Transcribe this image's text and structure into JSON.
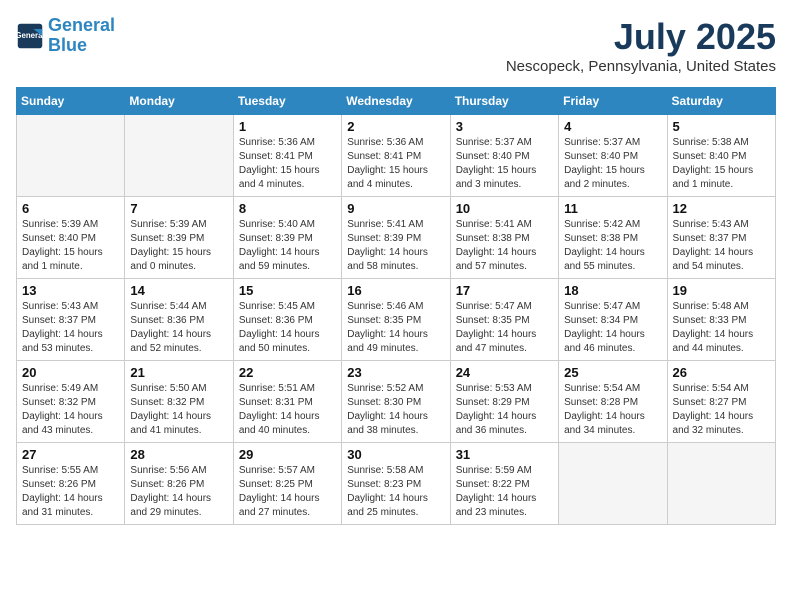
{
  "header": {
    "logo_line1": "General",
    "logo_line2": "Blue",
    "title": "July 2025",
    "subtitle": "Nescopeck, Pennsylvania, United States"
  },
  "days_of_week": [
    "Sunday",
    "Monday",
    "Tuesday",
    "Wednesday",
    "Thursday",
    "Friday",
    "Saturday"
  ],
  "weeks": [
    [
      {
        "day": "",
        "info": ""
      },
      {
        "day": "",
        "info": ""
      },
      {
        "day": "1",
        "info": "Sunrise: 5:36 AM\nSunset: 8:41 PM\nDaylight: 15 hours and 4 minutes."
      },
      {
        "day": "2",
        "info": "Sunrise: 5:36 AM\nSunset: 8:41 PM\nDaylight: 15 hours and 4 minutes."
      },
      {
        "day": "3",
        "info": "Sunrise: 5:37 AM\nSunset: 8:40 PM\nDaylight: 15 hours and 3 minutes."
      },
      {
        "day": "4",
        "info": "Sunrise: 5:37 AM\nSunset: 8:40 PM\nDaylight: 15 hours and 2 minutes."
      },
      {
        "day": "5",
        "info": "Sunrise: 5:38 AM\nSunset: 8:40 PM\nDaylight: 15 hours and 1 minute."
      }
    ],
    [
      {
        "day": "6",
        "info": "Sunrise: 5:39 AM\nSunset: 8:40 PM\nDaylight: 15 hours and 1 minute."
      },
      {
        "day": "7",
        "info": "Sunrise: 5:39 AM\nSunset: 8:39 PM\nDaylight: 15 hours and 0 minutes."
      },
      {
        "day": "8",
        "info": "Sunrise: 5:40 AM\nSunset: 8:39 PM\nDaylight: 14 hours and 59 minutes."
      },
      {
        "day": "9",
        "info": "Sunrise: 5:41 AM\nSunset: 8:39 PM\nDaylight: 14 hours and 58 minutes."
      },
      {
        "day": "10",
        "info": "Sunrise: 5:41 AM\nSunset: 8:38 PM\nDaylight: 14 hours and 57 minutes."
      },
      {
        "day": "11",
        "info": "Sunrise: 5:42 AM\nSunset: 8:38 PM\nDaylight: 14 hours and 55 minutes."
      },
      {
        "day": "12",
        "info": "Sunrise: 5:43 AM\nSunset: 8:37 PM\nDaylight: 14 hours and 54 minutes."
      }
    ],
    [
      {
        "day": "13",
        "info": "Sunrise: 5:43 AM\nSunset: 8:37 PM\nDaylight: 14 hours and 53 minutes."
      },
      {
        "day": "14",
        "info": "Sunrise: 5:44 AM\nSunset: 8:36 PM\nDaylight: 14 hours and 52 minutes."
      },
      {
        "day": "15",
        "info": "Sunrise: 5:45 AM\nSunset: 8:36 PM\nDaylight: 14 hours and 50 minutes."
      },
      {
        "day": "16",
        "info": "Sunrise: 5:46 AM\nSunset: 8:35 PM\nDaylight: 14 hours and 49 minutes."
      },
      {
        "day": "17",
        "info": "Sunrise: 5:47 AM\nSunset: 8:35 PM\nDaylight: 14 hours and 47 minutes."
      },
      {
        "day": "18",
        "info": "Sunrise: 5:47 AM\nSunset: 8:34 PM\nDaylight: 14 hours and 46 minutes."
      },
      {
        "day": "19",
        "info": "Sunrise: 5:48 AM\nSunset: 8:33 PM\nDaylight: 14 hours and 44 minutes."
      }
    ],
    [
      {
        "day": "20",
        "info": "Sunrise: 5:49 AM\nSunset: 8:32 PM\nDaylight: 14 hours and 43 minutes."
      },
      {
        "day": "21",
        "info": "Sunrise: 5:50 AM\nSunset: 8:32 PM\nDaylight: 14 hours and 41 minutes."
      },
      {
        "day": "22",
        "info": "Sunrise: 5:51 AM\nSunset: 8:31 PM\nDaylight: 14 hours and 40 minutes."
      },
      {
        "day": "23",
        "info": "Sunrise: 5:52 AM\nSunset: 8:30 PM\nDaylight: 14 hours and 38 minutes."
      },
      {
        "day": "24",
        "info": "Sunrise: 5:53 AM\nSunset: 8:29 PM\nDaylight: 14 hours and 36 minutes."
      },
      {
        "day": "25",
        "info": "Sunrise: 5:54 AM\nSunset: 8:28 PM\nDaylight: 14 hours and 34 minutes."
      },
      {
        "day": "26",
        "info": "Sunrise: 5:54 AM\nSunset: 8:27 PM\nDaylight: 14 hours and 32 minutes."
      }
    ],
    [
      {
        "day": "27",
        "info": "Sunrise: 5:55 AM\nSunset: 8:26 PM\nDaylight: 14 hours and 31 minutes."
      },
      {
        "day": "28",
        "info": "Sunrise: 5:56 AM\nSunset: 8:26 PM\nDaylight: 14 hours and 29 minutes."
      },
      {
        "day": "29",
        "info": "Sunrise: 5:57 AM\nSunset: 8:25 PM\nDaylight: 14 hours and 27 minutes."
      },
      {
        "day": "30",
        "info": "Sunrise: 5:58 AM\nSunset: 8:23 PM\nDaylight: 14 hours and 25 minutes."
      },
      {
        "day": "31",
        "info": "Sunrise: 5:59 AM\nSunset: 8:22 PM\nDaylight: 14 hours and 23 minutes."
      },
      {
        "day": "",
        "info": ""
      },
      {
        "day": "",
        "info": ""
      }
    ]
  ]
}
